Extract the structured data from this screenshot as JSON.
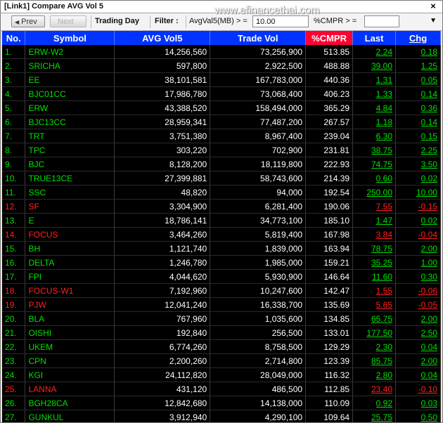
{
  "window": {
    "title": "[Link1] Compare AVG Vol 5"
  },
  "toolbar": {
    "prev_label": "Prev",
    "next_label": "Next",
    "trading_day_label": "Trading Day",
    "filter_label": "Filter :",
    "avgvol_label": "AvgVal5(MB) > =",
    "avgvol_value": "10.00",
    "cmpr_label": "%CMPR > =",
    "cmpr_value": ""
  },
  "watermark": "www.efinancethai.com",
  "table": {
    "headers": [
      "No.",
      "Symbol",
      "AVG Vol5",
      "Trade Vol",
      "%CMPR",
      "Last",
      "Chg"
    ],
    "rows": [
      {
        "no": "1.",
        "symbol": "ERW-W2",
        "avg": "14,256,560",
        "trade": "73,256,900",
        "cmpr": "513.85",
        "last": "2.24",
        "chg": "0.18",
        "dir": "up"
      },
      {
        "no": "2.",
        "symbol": "SRICHA",
        "avg": "597,800",
        "trade": "2,922,500",
        "cmpr": "488.88",
        "last": "39.00",
        "chg": "1.25",
        "dir": "up"
      },
      {
        "no": "3.",
        "symbol": "EE",
        "avg": "38,101,581",
        "trade": "167,783,000",
        "cmpr": "440.36",
        "last": "1.31",
        "chg": "0.05",
        "dir": "up"
      },
      {
        "no": "4.",
        "symbol": "BJC01CC",
        "avg": "17,986,780",
        "trade": "73,068,400",
        "cmpr": "406.23",
        "last": "1.33",
        "chg": "0.14",
        "dir": "up"
      },
      {
        "no": "5.",
        "symbol": "ERW",
        "avg": "43,388,520",
        "trade": "158,494,000",
        "cmpr": "365.29",
        "last": "4.84",
        "chg": "0.36",
        "dir": "up"
      },
      {
        "no": "6.",
        "symbol": "BJC13CC",
        "avg": "28,959,341",
        "trade": "77,487,200",
        "cmpr": "267.57",
        "last": "1.18",
        "chg": "0.14",
        "dir": "up"
      },
      {
        "no": "7.",
        "symbol": "TRT",
        "avg": "3,751,380",
        "trade": "8,967,400",
        "cmpr": "239.04",
        "last": "6.30",
        "chg": "0.15",
        "dir": "up"
      },
      {
        "no": "8.",
        "symbol": "TPC",
        "avg": "303,220",
        "trade": "702,900",
        "cmpr": "231.81",
        "last": "38.75",
        "chg": "2.25",
        "dir": "up"
      },
      {
        "no": "9.",
        "symbol": "BJC",
        "avg": "8,128,200",
        "trade": "18,119,800",
        "cmpr": "222.93",
        "last": "74.75",
        "chg": "3.50",
        "dir": "up"
      },
      {
        "no": "10.",
        "symbol": "TRUE13CE",
        "avg": "27,399,881",
        "trade": "58,743,600",
        "cmpr": "214.39",
        "last": "0.60",
        "chg": "0.02",
        "dir": "up"
      },
      {
        "no": "11.",
        "symbol": "SSC",
        "avg": "48,820",
        "trade": "94,000",
        "cmpr": "192.54",
        "last": "250.00",
        "chg": "10.00",
        "dir": "up"
      },
      {
        "no": "12.",
        "symbol": "SF",
        "avg": "3,304,900",
        "trade": "6,281,400",
        "cmpr": "190.06",
        "last": "7.55",
        "chg": "-0.15",
        "dir": "down"
      },
      {
        "no": "13.",
        "symbol": "E",
        "avg": "18,786,141",
        "trade": "34,773,100",
        "cmpr": "185.10",
        "last": "1.47",
        "chg": "0.02",
        "dir": "up"
      },
      {
        "no": "14.",
        "symbol": "FOCUS",
        "avg": "3,464,260",
        "trade": "5,819,400",
        "cmpr": "167.98",
        "last": "3.84",
        "chg": "-0.04",
        "dir": "down"
      },
      {
        "no": "15.",
        "symbol": "BH",
        "avg": "1,121,740",
        "trade": "1,839,000",
        "cmpr": "163.94",
        "last": "78.75",
        "chg": "2.00",
        "dir": "up"
      },
      {
        "no": "16.",
        "symbol": "DELTA",
        "avg": "1,246,780",
        "trade": "1,985,000",
        "cmpr": "159.21",
        "last": "35.25",
        "chg": "1.00",
        "dir": "up"
      },
      {
        "no": "17.",
        "symbol": "FPI",
        "avg": "4,044,620",
        "trade": "5,930,900",
        "cmpr": "146.64",
        "last": "11.60",
        "chg": "0.30",
        "dir": "up"
      },
      {
        "no": "18.",
        "symbol": "FOCUS-W1",
        "avg": "7,192,960",
        "trade": "10,247,600",
        "cmpr": "142.47",
        "last": "1.55",
        "chg": "-0.06",
        "dir": "down"
      },
      {
        "no": "19.",
        "symbol": "PJW",
        "avg": "12,041,240",
        "trade": "16,338,700",
        "cmpr": "135.69",
        "last": "5.65",
        "chg": "-0.05",
        "dir": "down"
      },
      {
        "no": "20.",
        "symbol": "BLA",
        "avg": "767,960",
        "trade": "1,035,600",
        "cmpr": "134.85",
        "last": "65.75",
        "chg": "2.00",
        "dir": "up"
      },
      {
        "no": "21.",
        "symbol": "OISHI",
        "avg": "192,840",
        "trade": "256,500",
        "cmpr": "133.01",
        "last": "177.50",
        "chg": "2.50",
        "dir": "up"
      },
      {
        "no": "22.",
        "symbol": "UKEM",
        "avg": "6,774,260",
        "trade": "8,758,500",
        "cmpr": "129.29",
        "last": "2.30",
        "chg": "0.04",
        "dir": "up"
      },
      {
        "no": "23.",
        "symbol": "CPN",
        "avg": "2,200,260",
        "trade": "2,714,800",
        "cmpr": "123.39",
        "last": "85.75",
        "chg": "2.00",
        "dir": "up"
      },
      {
        "no": "24.",
        "symbol": "KGI",
        "avg": "24,112,820",
        "trade": "28,049,000",
        "cmpr": "116.32",
        "last": "2.80",
        "chg": "0.04",
        "dir": "up"
      },
      {
        "no": "25.",
        "symbol": "LANNA",
        "avg": "431,120",
        "trade": "486,500",
        "cmpr": "112.85",
        "last": "23.40",
        "chg": "-0.10",
        "dir": "down"
      },
      {
        "no": "26.",
        "symbol": "BGH28CA",
        "avg": "12,842,680",
        "trade": "14,138,000",
        "cmpr": "110.09",
        "last": "0.92",
        "chg": "0.03",
        "dir": "up"
      },
      {
        "no": "27.",
        "symbol": "GUNKUL",
        "avg": "3,912,940",
        "trade": "4,290,100",
        "cmpr": "109.64",
        "last": "25.75",
        "chg": "0.50",
        "dir": "up"
      }
    ]
  }
}
